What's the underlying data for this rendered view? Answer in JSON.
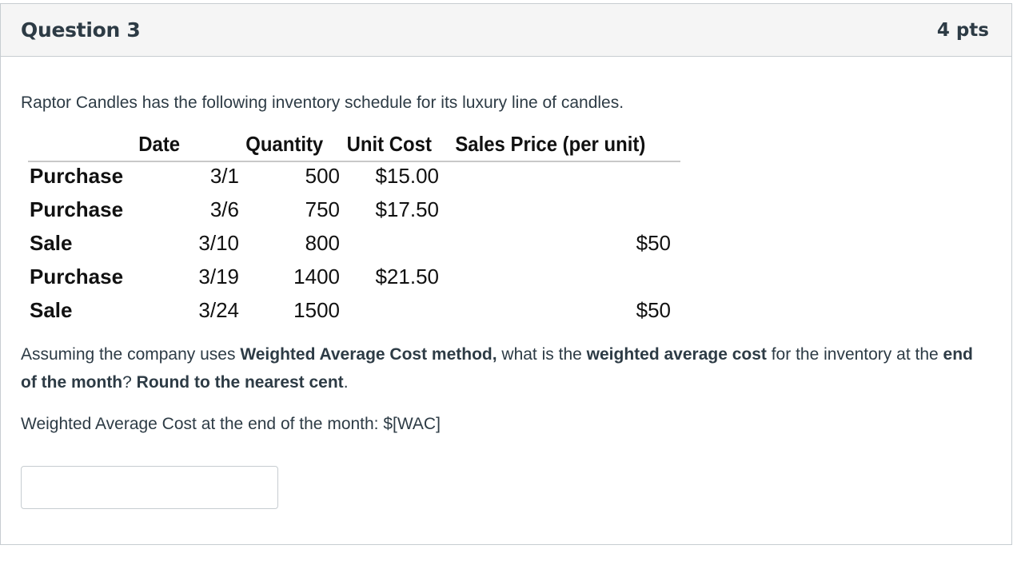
{
  "question": {
    "title": "Question 3",
    "points": "4 pts"
  },
  "intro": "Raptor Candles has the following inventory schedule for its luxury line of candles.",
  "schedule": {
    "headers": {
      "date": "Date",
      "quantity": "Quantity",
      "unit_cost": "Unit Cost",
      "sales_price": "Sales Price (per unit)"
    },
    "rows": [
      {
        "type": "Purchase",
        "date": "3/1",
        "quantity": "500",
        "unit_cost": "$15.00",
        "sales_price": ""
      },
      {
        "type": "Purchase",
        "date": "3/6",
        "quantity": "750",
        "unit_cost": "$17.50",
        "sales_price": ""
      },
      {
        "type": "Sale",
        "date": "3/10",
        "quantity": "800",
        "unit_cost": "",
        "sales_price": "$50"
      },
      {
        "type": "Purchase",
        "date": "3/19",
        "quantity": "1400",
        "unit_cost": "$21.50",
        "sales_price": ""
      },
      {
        "type": "Sale",
        "date": "3/24",
        "quantity": "1500",
        "unit_cost": "",
        "sales_price": "$50"
      }
    ]
  },
  "prompt": {
    "p1": "Assuming the company uses ",
    "b1": "Weighted Average Cost method,",
    "p2": " what is the ",
    "b2": "weighted average cost",
    "p3": " for the inventory at the ",
    "b3": "end of the month",
    "p4": "? ",
    "b4": "Round to the nearest cent",
    "p5": "."
  },
  "answer_line": "Weighted Average Cost at the end of the month: $[WAC]",
  "answer_input": {
    "value": "",
    "placeholder": ""
  }
}
